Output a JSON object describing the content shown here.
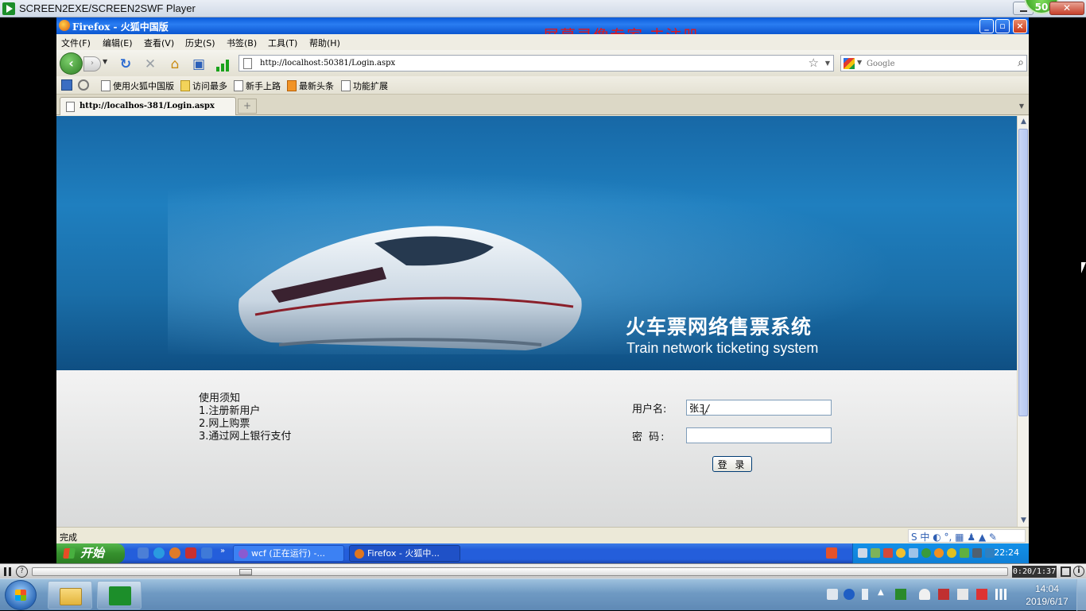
{
  "player": {
    "title": "SCREEN2EXE/SCREEN2SWF Player",
    "badge": "50",
    "close_glyph": "✕",
    "time": "0:20/1:37",
    "progress_fraction": 0.215,
    "info_glyph": "?",
    "help_glyph": "i"
  },
  "firefox": {
    "title": "Firefox - 火狐中国版",
    "watermark": "屏幕录像专家  未注册",
    "menu": [
      "文件(F)",
      "编辑(E)",
      "查看(V)",
      "历史(S)",
      "书签(B)",
      "工具(T)",
      "帮助(H)"
    ],
    "url": "http://localhost:50381/Login.aspx",
    "search_placeholder": "Google",
    "bookmarks": [
      "使用火狐中国版",
      "访问最多",
      "新手上路",
      "最新头条",
      "功能扩展"
    ],
    "tab_label": "http://localhos-381/Login.aspx",
    "new_tab_glyph": "+",
    "status": "完成",
    "ime_text": "S 中 ◐ °, ▦ ♟ ▲ ✎"
  },
  "page": {
    "banner_cn": "火车票网络售票系统",
    "banner_en": "Train network ticketing system",
    "notice": [
      "使用须知",
      "1.注册新用户",
      "2.网上购票",
      "3.通过网上银行支付"
    ],
    "username_label": "用户名:",
    "username_value": "张三",
    "password_label": "密  码:",
    "login_label": "登 录"
  },
  "xp_taskbar": {
    "start": "开始",
    "tasks": [
      "wcf (正在运行) -...",
      "Firefox - 火狐中..."
    ],
    "clock": "22:24"
  },
  "win7_taskbar": {
    "time": "14:04",
    "date": "2019/6/17"
  },
  "colors": {
    "banner_blue": "#1f7fbf",
    "watermark_red": "#e3171a",
    "xp_blue": "#245edb"
  }
}
